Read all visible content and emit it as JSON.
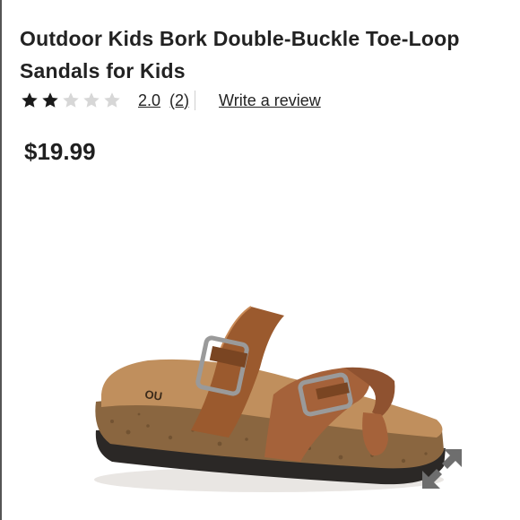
{
  "product": {
    "title": "Outdoor Kids Bork Double-Buckle Toe-Loop Sandals for Kids",
    "rating": {
      "value_label": "2.0",
      "count_label": "(2)",
      "stars_filled": 2,
      "stars_total": 5
    },
    "write_review_label": "Write a review",
    "price": "$19.99",
    "image": {
      "alt": "Brown double-buckle toe-loop sandal",
      "sole_print": "OU"
    }
  },
  "colors": {
    "text": "#222222",
    "star_filled": "#1a1a1a",
    "star_empty": "#d7d7d7",
    "leather": "#9b5a2e",
    "cork": "#8a6640",
    "sole": "#2b2826"
  },
  "icons": {
    "star": "star-icon",
    "expand": "expand-icon"
  }
}
